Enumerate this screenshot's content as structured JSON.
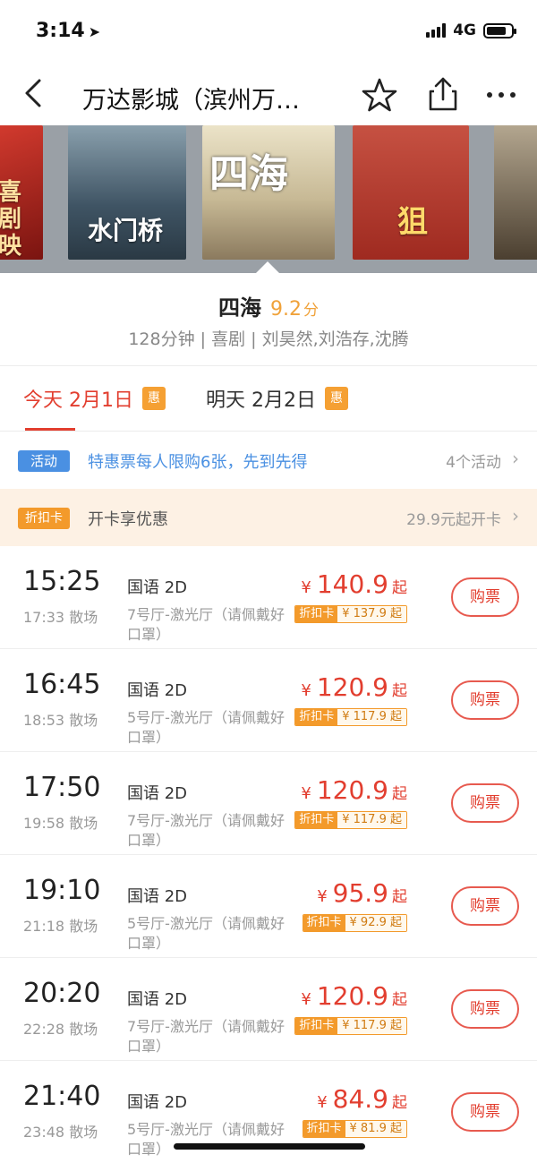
{
  "status_bar": {
    "time": "3:14",
    "network": "4G"
  },
  "nav": {
    "title": "万达影城（滨州万…"
  },
  "posters": [
    {
      "text": "喜剧\n映",
      "color": "#c0322a"
    },
    {
      "text": "水门桥",
      "color": "#5a6f7e"
    },
    {
      "text": "四海",
      "color": "#d9cfa8"
    },
    {
      "text": "狙",
      "color": "#c6493a"
    },
    {
      "text": "",
      "color": "#7a6a55"
    }
  ],
  "movie": {
    "title": "四海",
    "score": "9.2",
    "score_unit": "分",
    "meta": "128分钟 | 喜剧 | 刘昊然,刘浩存,沈腾"
  },
  "dates": [
    {
      "label": "今天 2月1日",
      "badge": "惠",
      "active": true
    },
    {
      "label": "明天 2月2日",
      "badge": "惠",
      "active": false
    }
  ],
  "promo": {
    "badge": "活动",
    "text": "特惠票每人限购6张，先到先得",
    "count": "4个活动"
  },
  "discount_card": {
    "badge": "折扣卡",
    "text": "开卡享优惠",
    "price": "29.9元起开卡"
  },
  "showtimes": [
    {
      "time": "15:25",
      "end": "17:33 散场",
      "lang": "国语 2D",
      "hall": "7号厅-激光厅（请佩戴好口罩）",
      "price": "140.9",
      "card_label": "折扣卡",
      "card_price": "¥ 137.9 起",
      "buy": "购票"
    },
    {
      "time": "16:45",
      "end": "18:53 散场",
      "lang": "国语 2D",
      "hall": "5号厅-激光厅（请佩戴好口罩）",
      "price": "120.9",
      "card_label": "折扣卡",
      "card_price": "¥ 117.9 起",
      "buy": "购票"
    },
    {
      "time": "17:50",
      "end": "19:58 散场",
      "lang": "国语 2D",
      "hall": "7号厅-激光厅（请佩戴好口罩）",
      "price": "120.9",
      "card_label": "折扣卡",
      "card_price": "¥ 117.9 起",
      "buy": "购票"
    },
    {
      "time": "19:10",
      "end": "21:18 散场",
      "lang": "国语 2D",
      "hall": "5号厅-激光厅（请佩戴好口罩）",
      "price": "95.9",
      "card_label": "折扣卡",
      "card_price": "¥ 92.9 起",
      "buy": "购票"
    },
    {
      "time": "20:20",
      "end": "22:28 散场",
      "lang": "国语 2D",
      "hall": "7号厅-激光厅（请佩戴好口罩）",
      "price": "120.9",
      "card_label": "折扣卡",
      "card_price": "¥ 117.9 起",
      "buy": "购票"
    },
    {
      "time": "21:40",
      "end": "23:48 散场",
      "lang": "国语 2D",
      "hall": "5号厅-激光厅（请佩戴好口罩）",
      "price": "84.9",
      "card_label": "折扣卡",
      "card_price": "¥ 81.9 起",
      "buy": "购票"
    }
  ],
  "price_prefix": "¥",
  "price_suffix": "起",
  "colors": {
    "accent": "#e23e2f",
    "score": "#f0a23a",
    "promo": "#4a90e2",
    "card": "#f39a2b"
  }
}
